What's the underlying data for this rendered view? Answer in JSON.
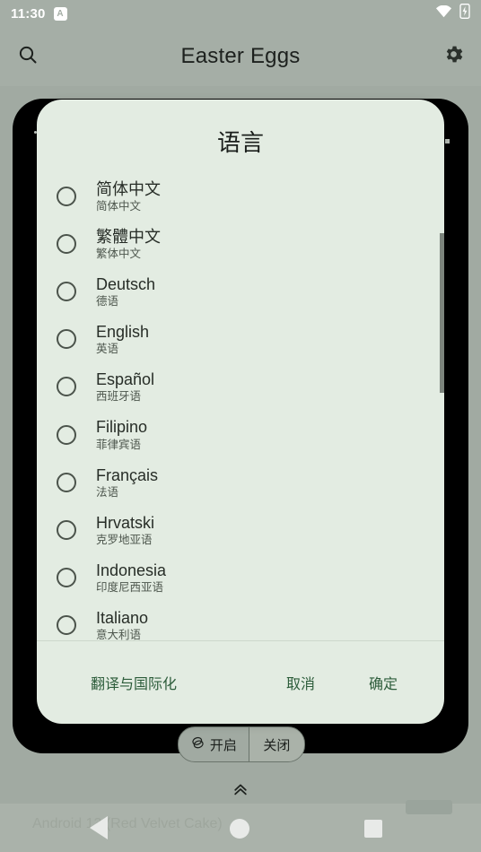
{
  "status_bar": {
    "time": "11:30",
    "badge_label": "A",
    "wifi_icon": "wifi-icon",
    "battery_icon": "battery-charging-icon"
  },
  "toolbar": {
    "title": "Easter Eggs",
    "search_icon": "search-icon",
    "settings_icon": "gear-icon"
  },
  "dialog": {
    "title": "语言",
    "languages": [
      {
        "primary": "简体中文",
        "secondary": "简体中文",
        "selected": false
      },
      {
        "primary": "繁體中文",
        "secondary": "繁体中文",
        "selected": false
      },
      {
        "primary": "Deutsch",
        "secondary": "德语",
        "selected": false
      },
      {
        "primary": "English",
        "secondary": "英语",
        "selected": false
      },
      {
        "primary": "Español",
        "secondary": "西班牙语",
        "selected": false
      },
      {
        "primary": "Filipino",
        "secondary": "菲律宾语",
        "selected": false
      },
      {
        "primary": "Français",
        "secondary": "法语",
        "selected": false
      },
      {
        "primary": "Hrvatski",
        "secondary": "克罗地亚语",
        "selected": false
      },
      {
        "primary": "Indonesia",
        "secondary": "印度尼西亚语",
        "selected": false
      },
      {
        "primary": "Italiano",
        "secondary": "意大利语",
        "selected": false
      }
    ],
    "actions": {
      "translate_label": "翻译与国际化",
      "cancel_label": "取消",
      "confirm_label": "确定"
    },
    "accent_color": "#2c5c3a",
    "surface_color": "#e3ece2"
  },
  "background": {
    "segmented_toggle": {
      "on_label": "开启",
      "off_label": "关闭",
      "on_icon": "layers-icon",
      "selected": "关闭"
    },
    "expand_icon": "chevron-double-up-icon"
  },
  "nav_bar": {
    "caption": "Android 13 (Red Velvet Cake)",
    "back_icon": "back-triangle-icon",
    "home_icon": "home-circle-icon",
    "recents_icon": "recents-square-icon"
  }
}
